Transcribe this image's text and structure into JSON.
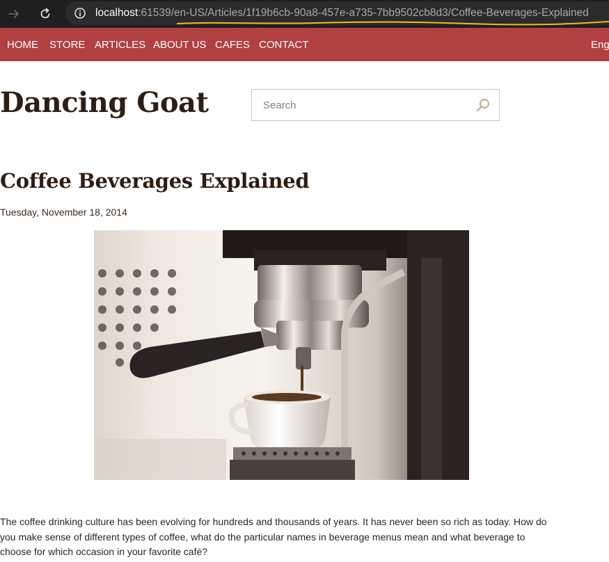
{
  "browser": {
    "url_host": "localhost",
    "url_rest": ":61539/en-US/Articles/1f19b6cb-90a8-457e-a735-7bb9502cb8d3/Coffee-Beverages-Explained",
    "icons": [
      "forward-arrow-icon",
      "reload-icon",
      "info-icon"
    ]
  },
  "nav": {
    "home": "HOME",
    "store": "STORE",
    "articles": "ARTICLES",
    "about": "ABOUT US",
    "cafes": "CAFES",
    "contact": "CONTACT",
    "language": "Eng"
  },
  "header": {
    "brand": "Dancing Goat",
    "search_placeholder": "Search",
    "search_icon": "magnifier-icon"
  },
  "article": {
    "title": "Coffee Beverages Explained",
    "date": "Tuesday, November 18, 2014",
    "body": "The coffee drinking culture has been evolving for hundreds and thousands of years. It has never been so rich as today. How do you make sense of different types of coffee, what do the particular names in beverage menus mean and what beverage to choose for which occasion in your favorite café?"
  },
  "colors": {
    "nav_bar": "#b04140",
    "brand_text": "#2d1e14",
    "search_border": "#d8c2a8",
    "browser_bar": "#1f1f1f",
    "url_underline": "#e8c21a"
  }
}
